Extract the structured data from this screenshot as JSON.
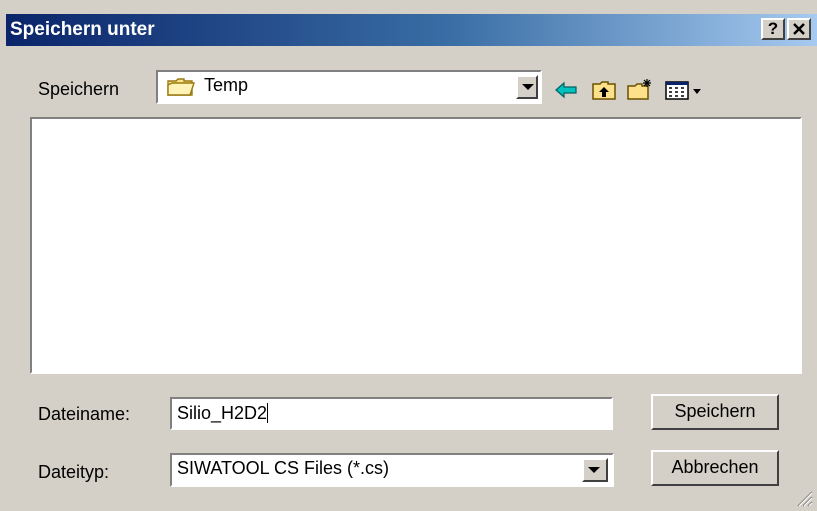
{
  "dialog": {
    "title": "Speichern unter",
    "help_button": "?",
    "close_button": "X"
  },
  "save_in": {
    "label": "Speichern",
    "folder": "Temp",
    "icons": [
      "back-arrow-icon",
      "up-folder-icon",
      "new-folder-icon",
      "view-menu-icon"
    ]
  },
  "file_list": {
    "items": []
  },
  "filename": {
    "label": "Dateiname:",
    "value": "Silio_H2D2"
  },
  "filetype": {
    "label": "Dateityp:",
    "value": "SIWATOOL CS Files (*.cs)"
  },
  "buttons": {
    "save": "Speichern",
    "cancel": "Abbrechen"
  },
  "colors": {
    "titlebar_start": "#0a246a",
    "titlebar_end": "#a6caf0",
    "face": "#d4d0c8",
    "back_arrow": "#00c0c0"
  }
}
